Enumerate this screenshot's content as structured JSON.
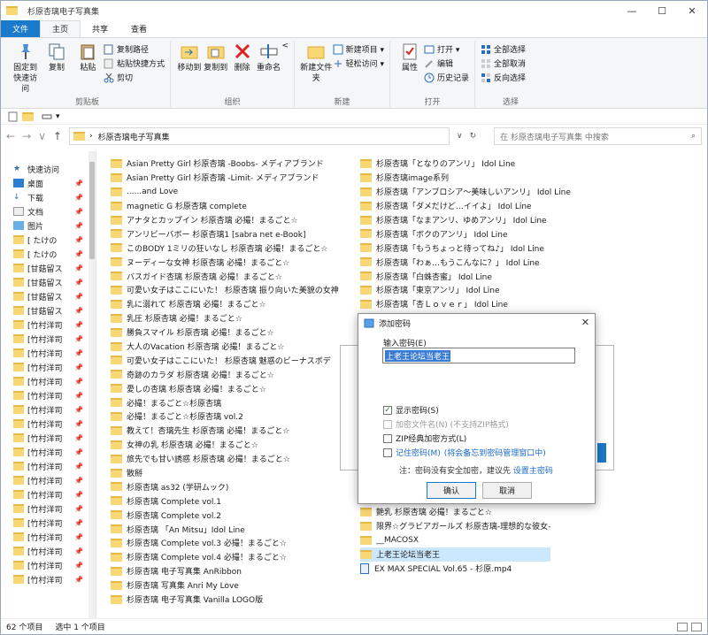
{
  "window": {
    "title": "杉原杏璃电子写真集",
    "controls": [
      "—",
      "☐",
      "✕"
    ]
  },
  "tabs": [
    "文件",
    "主页",
    "共享",
    "查看"
  ],
  "ribbon": {
    "clipboard": {
      "pin": "固定到快速访问",
      "copy": "复制",
      "paste": "粘贴",
      "copy_path": "复制路径",
      "paste_shortcut": "粘贴快捷方式",
      "cut": "剪切",
      "label": "剪贴板"
    },
    "organize": {
      "move_to": "移动到",
      "copy_to": "复制到",
      "delete": "删除",
      "rename": "重命名",
      "label": "组织"
    },
    "new": {
      "new_folder": "新建文件夹",
      "new_item": "新建项目 ▾",
      "easy_access": "轻松访问 ▾",
      "label": "新建"
    },
    "open": {
      "properties": "属性",
      "open": "打开 ▾",
      "edit": "编辑",
      "history": "历史记录",
      "label": "打开"
    },
    "select": {
      "select_all": "全部选择",
      "select_none": "全部取消",
      "invert": "反向选择",
      "label": "选择"
    }
  },
  "nav": {
    "address": "杉原杏璃电子写真集",
    "search_placeholder": "在 杉原杏璃电子写真集 中搜索"
  },
  "sidebar": [
    "快速访问",
    "桌面",
    "下载",
    "文档",
    "图片",
    "[ たけの",
    "[ たけの",
    "[甘菇留ス",
    "[甘菇留ス",
    "[甘菇留ス",
    "[甘菇留ス",
    "[竹村洋司",
    "[竹村洋司",
    "[竹村洋司",
    "[竹村洋司",
    "[竹村洋司",
    "[竹村洋司",
    "[竹村洋司",
    "[竹村洋司",
    "[竹村洋司",
    "[竹村洋司",
    "[竹村洋司",
    "[竹村洋司",
    "[竹村洋司",
    "[竹村洋司",
    "[竹村洋司",
    "[竹村洋司",
    "[竹村洋司",
    "[竹村洋司",
    "[竹村洋司"
  ],
  "files_col1": [
    "Asian Pretty Girl 杉原杏璃 -Boobs- メディアブランド",
    "Asian Pretty Girl 杉原杏璃 -Limit- メディアブランド",
    "......and Love",
    "magnetic G 杉原杏璃 complete",
    "アナタとカップイン 杉原杏璃 必撮！まるごと☆",
    "アンリビーバボー 杉原杏璃1 [sabra net e-Book]",
    "このBODY 1ミリの狂いなし 杉原杏璃 必撮！まるごと☆",
    "ヌーディーな女神 杉原杏璃 必撮！まるごと☆",
    "バスガイド杏璃 杉原杏璃 必撮！まるごと☆",
    "可愛い女子はここにいた！ 杉原杏璃 振り向いた美貌の女神",
    "乳に溺れて 杉原杏璃 必撮！まるごと☆",
    "乳圧 杉原杏璃 必撮！まるごと☆",
    "勝負スマイル 杉原杏璃 必撮！まるごと☆",
    "大人のVacation 杉原杏璃 必撮！まるごと☆",
    "可愛い女子はここにいた！ 杉原杏璃 魅惑のビーナスボデ",
    "奇跡のカラダ 杉原杏璃 必撮！まるごと☆",
    "愛しの杏璃 杉原杏璃 必撮！まるごと☆",
    "必撮！まるごと☆杉原杏璃",
    "必撮！まるごと☆杉原杏璃 vol.2",
    "教えて！杏璃先生 杉原杏璃 必撮！まるごと☆",
    "女神の乳 杉原杏璃 必撮！まるごと☆",
    "旅先でも甘い誘惑 杉原杏璃 必撮！まるごと☆",
    "散掰",
    "杉原杏璃 as32 (学研ムック)",
    "杉原杏璃 Complete vol.1",
    "杉原杏璃 Complete vol.2",
    "杉原杏璃 「An Mitsu」Idol Line",
    "杉原杏璃 Complete vol.3 必撮！まるごと☆",
    "杉原杏璃 Complete vol.4 必撮！まるごと☆",
    "杉原杏璃 电子写真集 AnRibbon",
    "杉原杏璃 写真集 Anri My Love",
    "杉原杏璃 电子写真集 Vanilla LOGO版"
  ],
  "files_col2": [
    "杉原杏璃「となりのアンリ」 Idol Line",
    "杉原杏璃image系列",
    "杉原杏璃「アンブロシア～美味しいアンリ」 Idol Line",
    "杉原杏璃「ダメだけど…イイよ」 Idol Line",
    "杉原杏璃「なまアンリ、ゆめアンリ」 Idol Line",
    "杉原杏璃「ボクのアンリ」 Idol Line",
    "杉原杏璃「もうちょっと待ってね♪」 Idol Line",
    "杉原杏璃「わぁ…もうこんなに？」 Idol Line",
    "杉原杏璃「白蛛杏蜜」 Idol Line",
    "杉原杏璃「東京アンリ」 Idol Line",
    "杉原杏璃「杏Ｌｏｖｅｒ」 Idol Line"
  ],
  "files_col2_bottom": [
    {
      "name": "艶乳 杉原杏璃 必撮！まるごと☆",
      "type": "folder"
    },
    {
      "name": "限界☆グラビアガールズ 杉原杏璃-理想的な彼女-",
      "type": "folder"
    },
    {
      "name": "__MACOSX",
      "type": "folder"
    },
    {
      "name": "上老王论坛当老王",
      "type": "folder",
      "selected": true
    },
    {
      "name": "EX MAX SPECIAL  Vol.65 - 杉原.mp4",
      "type": "mp4"
    }
  ],
  "status": {
    "count": "62 个项目",
    "selected": "选中 1 个项目"
  },
  "dialog": {
    "title": "添加密码",
    "label": "输入密码(E)",
    "password": "上老王论坛当老王",
    "show_password": "显示密码(S)",
    "encrypt_names": "加密文件名(N) (不支持ZIP格式)",
    "zip_classic": "ZIP经典加密方式(L)",
    "remember": "记住密码(M)",
    "remember_hint": "(将会备忘到密码管理窗口中)",
    "note_prefix": "注：密码没有安全加密，建议先",
    "note_link": "设置主密码",
    "ok": "确认",
    "cancel": "取消"
  }
}
